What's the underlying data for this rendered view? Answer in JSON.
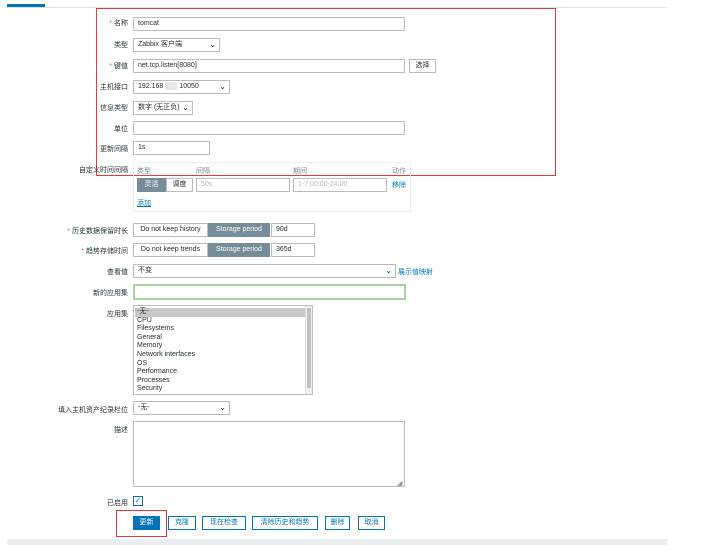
{
  "form": {
    "name": {
      "label": "名称",
      "value": "tomcat"
    },
    "type": {
      "label": "类型",
      "value": "Zabbix 客户端"
    },
    "key": {
      "label": "键值",
      "value": "net.tcp.listen[8080]",
      "select_button": "选择"
    },
    "host_interface": {
      "label": "主机接口",
      "value_a": "192.168",
      "value_b": "10050"
    },
    "info_type": {
      "label": "信息类型",
      "value": "数字 (无正负)"
    },
    "units": {
      "label": "单位",
      "value": ""
    },
    "update_interval": {
      "label": "更新间隔",
      "value": "1s"
    },
    "custom_intervals": {
      "label": "自定义时间间隔",
      "headers": {
        "type": "类型",
        "interval": "间隔",
        "period": "期间",
        "action": "动作"
      },
      "row": {
        "flexible": "灵活",
        "scheduling": "调度",
        "interval_placeholder": "50s",
        "period_placeholder": "1-7,00:00-24:00",
        "remove": "移除"
      },
      "add": "添加"
    },
    "history": {
      "label": "历史数据保留时长",
      "option_off": "Do not keep history",
      "option_on": "Storage period",
      "value": "90d"
    },
    "trends": {
      "label": "趋势存储时间",
      "option_off": "Do not keep trends",
      "option_on": "Storage period",
      "value": "365d"
    },
    "value_map": {
      "label": "查看值",
      "value": "不变",
      "link": "展示值映射"
    },
    "new_application": {
      "label": "新的应用集",
      "value": ""
    },
    "applications": {
      "label": "应用集",
      "items": [
        "-无-",
        "CPU",
        "Filesystems",
        "General",
        "Memory",
        "Network interfaces",
        "OS",
        "Performance",
        "Processes",
        "Security"
      ]
    },
    "inventory_field": {
      "label": "填入主机资产纪录栏位",
      "value": "-无-"
    },
    "description": {
      "label": "描述",
      "value": ""
    },
    "enabled": {
      "label": "已启用",
      "checked": true
    }
  },
  "buttons": {
    "update": "更新",
    "clone": "克隆",
    "check_now": "现在检查",
    "clear_history": "清除历史和趋势",
    "delete": "删除",
    "cancel": "取消"
  },
  "colors": {
    "accent": "#0275b8",
    "annotation_red": "#e23b3b",
    "focus_green": "#a8d5a2",
    "segment_on": "#768d99"
  }
}
